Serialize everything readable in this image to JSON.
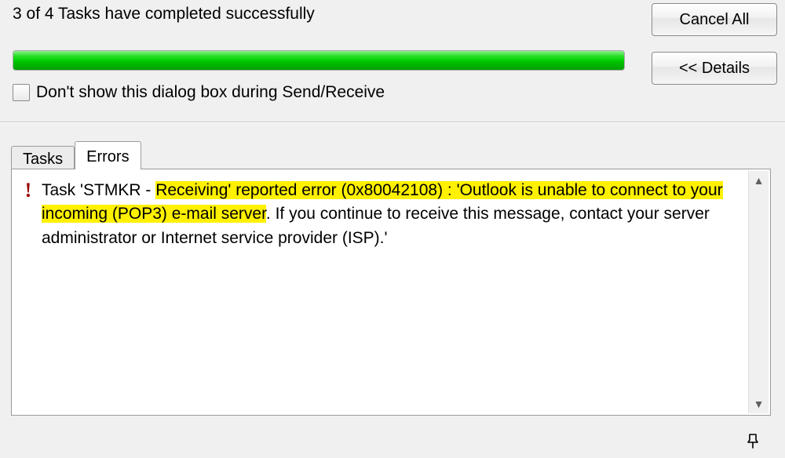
{
  "status_line": "3 of 4 Tasks have completed successfully",
  "buttons": {
    "cancel_all": "Cancel All",
    "details": "<< Details"
  },
  "dont_show_label": "Don't show this dialog box during Send/Receive",
  "tabs": {
    "tasks": "Tasks",
    "errors": "Errors"
  },
  "active_tab": "errors",
  "progress_percent": 100,
  "error": {
    "prefix": "Task 'STMKR - ",
    "highlighted": "Receiving' reported error (0x80042108) : 'Outlook is unable to connect to your incoming (POP3) e-mail server",
    "suffix": ". If you continue to receive this message, contact your server administrator or Internet service provider (ISP).'"
  }
}
